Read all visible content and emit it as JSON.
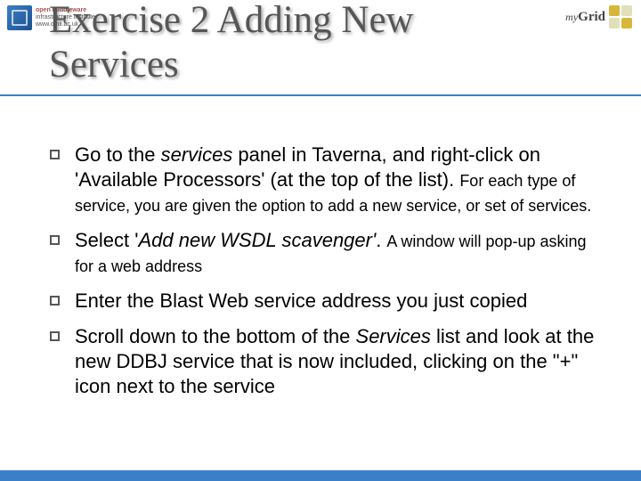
{
  "header": {
    "title": "Exercise 2 Adding New Services",
    "omii_line1": "open middleware",
    "omii_line2": "infrastructure institute",
    "omii_line3": "www.omii.ac.uk",
    "mygrid_my": "my",
    "mygrid_grid": "Grid"
  },
  "bullets": {
    "b1_a": "Go to the ",
    "b1_b": "services",
    "b1_c": " panel in Taverna, and right-click on 'Available Processors' (at the top of the list). ",
    "b1_d": "For each type of service, you are given the option to add a new service, or set of services.",
    "b2_a": "Select '",
    "b2_b": "Add new WSDL scavenger'",
    "b2_c": ". ",
    "b2_d": "A window will pop-up asking for a web address",
    "b3": "Enter the Blast Web service address you just copied",
    "b4_a": "Scroll down to the bottom of the ",
    "b4_b": "Services",
    "b4_c": " list and look at the new DDBJ service that is now included, clicking on the \"+\" icon next to the service"
  }
}
